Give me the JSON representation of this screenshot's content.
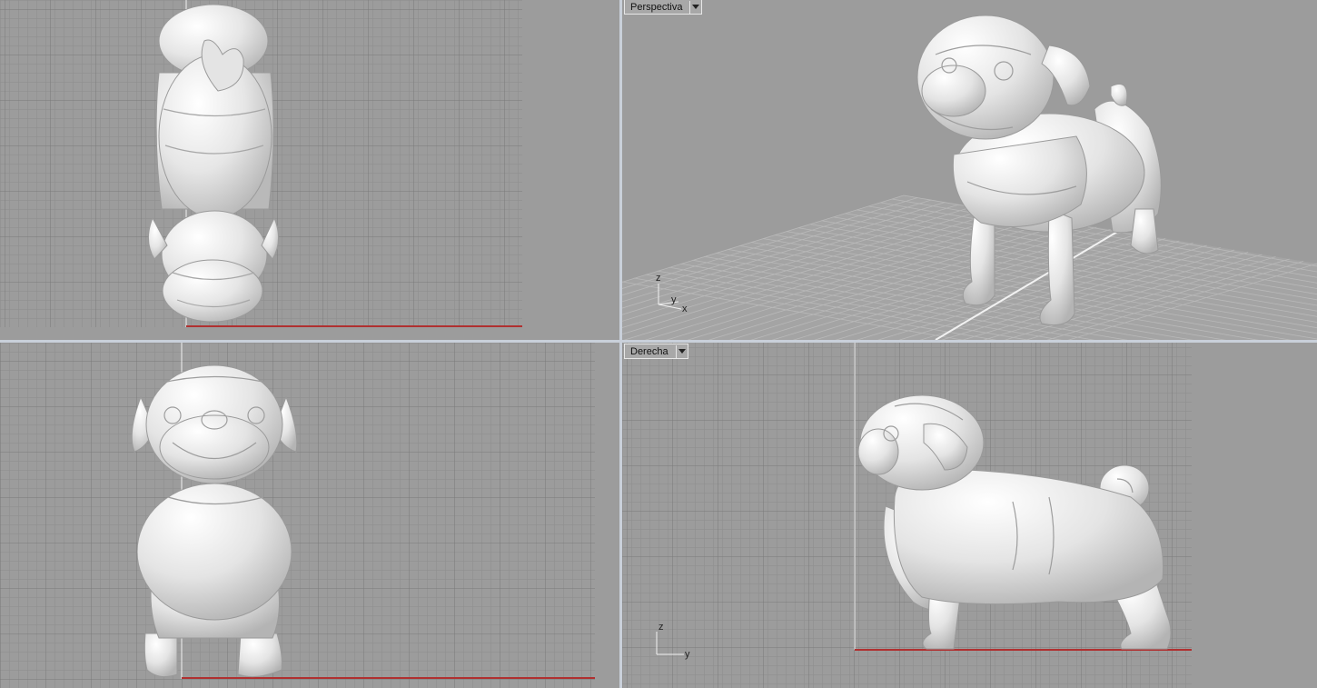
{
  "viewports": {
    "top": {
      "label": ""
    },
    "perspective": {
      "label": "Perspectiva"
    },
    "front": {
      "label": ""
    },
    "right": {
      "label": "Derecha"
    }
  },
  "axes": {
    "perspective": {
      "z": "z",
      "y": "y",
      "x": "x"
    },
    "right": {
      "z": "z",
      "y": "y"
    }
  },
  "colors": {
    "viewport_bg": "#9c9c9c",
    "grid_minor": "#8d8d8d",
    "grid_major": "#7a7a7a",
    "axis_red": "#b03030",
    "axis_white": "#f2f2f2",
    "separator": "#c9d0da",
    "model": "#eeeeee"
  },
  "model_icon": "pug-figurine"
}
